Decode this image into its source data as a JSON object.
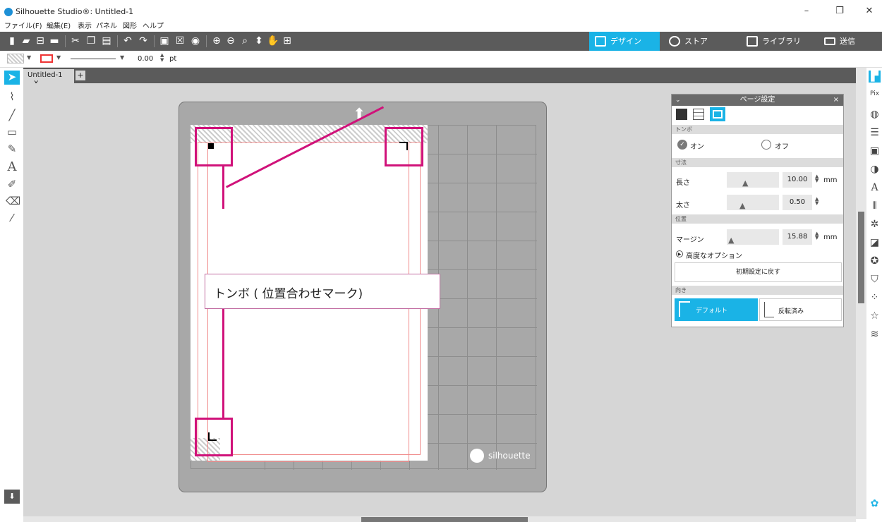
{
  "window": {
    "title": "Silhouette Studio®: Untitled-1",
    "minimize": "–",
    "maximize": "❐",
    "close": "✕"
  },
  "menu": [
    "ファイル(F)",
    "編集(E)",
    "表示",
    "パネル",
    "図形",
    "ヘルプ"
  ],
  "nav_tabs": [
    {
      "label": "デザイン",
      "active": true
    },
    {
      "label": "ストア",
      "active": false
    },
    {
      "label": "ライブラリ",
      "active": false
    },
    {
      "label": "送信",
      "active": false
    }
  ],
  "options": {
    "stroke_width": "0.00",
    "stroke_unit": "pt"
  },
  "doc_tab": {
    "name": "Untitled-1",
    "close": "×",
    "add": "+"
  },
  "callout": {
    "text": "トンボ ( 位置合わせマーク)"
  },
  "mat": {
    "brand": "silhouette"
  },
  "page_panel": {
    "title": "ページ設定",
    "sections": {
      "registration": "トンボ",
      "size": "寸法",
      "position": "位置",
      "orientation": "向き"
    },
    "on_label": "オン",
    "off_label": "オフ",
    "on_selected": true,
    "length_label": "長さ",
    "length_value": "10.00",
    "length_unit": "mm",
    "thickness_label": "太さ",
    "thickness_value": "0.50",
    "margin_label": "マージン",
    "margin_value": "15.88",
    "margin_unit": "mm",
    "advanced_label": "高度なオプション",
    "reset_label": "初期設定に戻す",
    "orient_default": "デフォルト",
    "orient_reversed": "反転済み"
  },
  "colors": {
    "accent": "#1ab3e6",
    "toolbar": "#5b5b5b",
    "highlight": "#d0127a",
    "cutline": "#f08a8a"
  }
}
